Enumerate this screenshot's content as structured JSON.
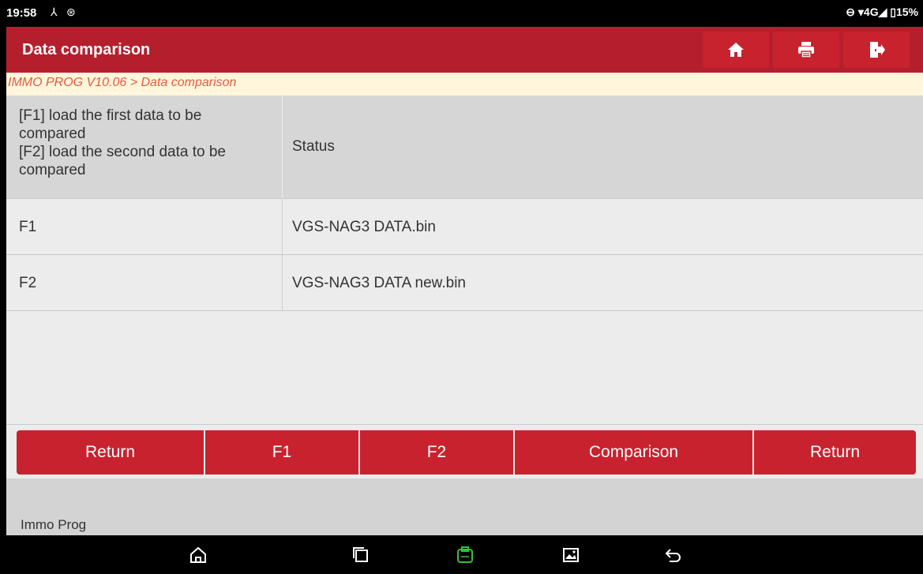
{
  "status_bar": {
    "time": "19:58",
    "right_text": "⊖ ▾4G◢ ▯15%"
  },
  "header": {
    "title": "Data comparison",
    "buttons": [
      "home-icon",
      "print-icon",
      "exit-icon"
    ]
  },
  "breadcrumb": "IMMO PROG V10.06 > Data comparison",
  "table": {
    "header_left": "[F1] load the first data to be compared\n[F2] load the second data to be compared",
    "header_right": "Status",
    "rows": [
      {
        "key": "F1",
        "value": "VGS-NAG3 DATA.bin"
      },
      {
        "key": "F2",
        "value": "VGS-NAG3 DATA new.bin"
      }
    ]
  },
  "actions": {
    "return_1": "Return",
    "f1": "F1",
    "f2": "F2",
    "comparison": "Comparison",
    "return_2": "Return"
  },
  "footer": {
    "app_name": "Immo Prog"
  },
  "colors": {
    "brand_red": "#b51f2d",
    "button_red": "#c8222f",
    "breadcrumb_text": "#e55b3c",
    "breadcrumb_bg": "#fff6dc"
  }
}
